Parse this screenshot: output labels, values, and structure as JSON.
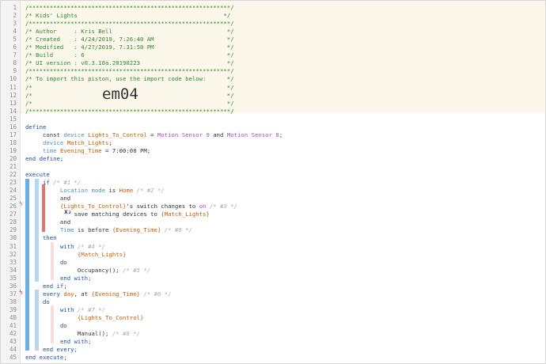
{
  "lines": [
    {
      "n": "1",
      "parts": [
        {
          "c": "cmt",
          "t": "/**********************************************************/"
        }
      ]
    },
    {
      "n": "2",
      "parts": [
        {
          "c": "cmt",
          "t": "/* Kids' Lights                                          */"
        }
      ]
    },
    {
      "n": "3",
      "parts": [
        {
          "c": "cmt",
          "t": "/**********************************************************/"
        }
      ]
    },
    {
      "n": "4",
      "parts": [
        {
          "c": "cmt",
          "t": "/* Author     : Kris Bell                                 */"
        }
      ]
    },
    {
      "n": "5",
      "parts": [
        {
          "c": "cmt",
          "t": "/* Created    : 4/24/2019, 7:26:40 AM                     */"
        }
      ]
    },
    {
      "n": "6",
      "parts": [
        {
          "c": "cmt",
          "t": "/* Modified   : 4/27/2019, 7:31:50 PM                     */"
        }
      ]
    },
    {
      "n": "7",
      "parts": [
        {
          "c": "cmt",
          "t": "/* Build      : 6                                         */"
        }
      ]
    },
    {
      "n": "8",
      "parts": [
        {
          "c": "cmt",
          "t": "/* UI version : v0.3.10a.20190223                         */"
        }
      ]
    },
    {
      "n": "9",
      "parts": [
        {
          "c": "cmt",
          "t": "/**********************************************************/"
        }
      ]
    },
    {
      "n": "10",
      "parts": [
        {
          "c": "cmt",
          "t": "/* To import this piston, use the import code below:      */"
        }
      ]
    },
    {
      "n": "11",
      "parts": [
        {
          "c": "cmt",
          "t": "/*                                                        */"
        }
      ]
    },
    {
      "n": "12",
      "parts": [
        {
          "c": "cmt",
          "t": "/*                                                        */"
        }
      ]
    },
    {
      "n": "13",
      "parts": [
        {
          "c": "cmt",
          "t": "/*                                                        */"
        }
      ]
    },
    {
      "n": "14",
      "parts": [
        {
          "c": "cmt",
          "t": "/**********************************************************/"
        }
      ]
    },
    {
      "n": "15",
      "parts": []
    },
    {
      "n": "16",
      "parts": [
        {
          "c": "kw",
          "t": "define"
        }
      ]
    },
    {
      "n": "17",
      "parts": [
        {
          "c": "plain",
          "t": "     const "
        },
        {
          "c": "ty",
          "t": "device "
        },
        {
          "c": "vr",
          "t": "Lights_To_Control"
        },
        {
          "c": "plain",
          "t": " = "
        },
        {
          "c": "dv",
          "t": "Motion Sensor 9"
        },
        {
          "c": "plain",
          "t": " and "
        },
        {
          "c": "dv",
          "t": "Motion Sensor 8"
        },
        {
          "c": "plain",
          "t": ";"
        }
      ]
    },
    {
      "n": "18",
      "parts": [
        {
          "c": "plain",
          "t": "     "
        },
        {
          "c": "ty",
          "t": "device "
        },
        {
          "c": "vr",
          "t": "Match_Lights"
        },
        {
          "c": "plain",
          "t": ";"
        }
      ]
    },
    {
      "n": "19",
      "parts": [
        {
          "c": "plain",
          "t": "     "
        },
        {
          "c": "ty",
          "t": "time "
        },
        {
          "c": "vr",
          "t": "Evening_Time"
        },
        {
          "c": "plain",
          "t": " = 7:00:00 PM;"
        }
      ]
    },
    {
      "n": "20",
      "parts": [
        {
          "c": "kw",
          "t": "end define;"
        }
      ]
    },
    {
      "n": "21",
      "parts": []
    },
    {
      "n": "22",
      "parts": [
        {
          "c": "kw",
          "t": "execute"
        }
      ]
    },
    {
      "n": "23",
      "parts": [
        {
          "c": "plain",
          "t": "     "
        },
        {
          "c": "kw",
          "t": "if "
        },
        {
          "c": "ic",
          "t": "/* #1 */"
        }
      ]
    },
    {
      "n": "24",
      "parts": [
        {
          "c": "plain",
          "t": "          "
        },
        {
          "c": "ty",
          "t": "Location mode"
        },
        {
          "c": "plain",
          "t": " is "
        },
        {
          "c": "vr",
          "t": "Home"
        },
        {
          "c": "ic",
          "t": " /* #2 */"
        }
      ]
    },
    {
      "n": "25",
      "parts": [
        {
          "c": "plain",
          "t": "          and"
        }
      ]
    },
    {
      "n": "26",
      "parts": [
        {
          "c": "plain",
          "t": "          "
        },
        {
          "c": "vr",
          "t": "{Lights_To_Control}"
        },
        {
          "c": "plain",
          "t": "'s switch changes to "
        },
        {
          "c": "st",
          "t": "on"
        },
        {
          "c": "ic",
          "t": " /* #3 */"
        }
      ]
    },
    {
      "n": "27",
      "parts": [
        {
          "c": "plain",
          "t": "              save matching devices to "
        },
        {
          "c": "vr",
          "t": "{Match_Lights}"
        }
      ]
    },
    {
      "n": "28",
      "parts": [
        {
          "c": "plain",
          "t": "          and"
        }
      ]
    },
    {
      "n": "29",
      "parts": [
        {
          "c": "plain",
          "t": "          "
        },
        {
          "c": "ty",
          "t": "Time"
        },
        {
          "c": "plain",
          "t": " is before "
        },
        {
          "c": "vr",
          "t": "{Evening_Time}"
        },
        {
          "c": "ic",
          "t": " /* #9 */"
        }
      ]
    },
    {
      "n": "30",
      "parts": [
        {
          "c": "plain",
          "t": "     "
        },
        {
          "c": "kw",
          "t": "then"
        }
      ]
    },
    {
      "n": "31",
      "parts": [
        {
          "c": "plain",
          "t": "          "
        },
        {
          "c": "kw",
          "t": "with "
        },
        {
          "c": "ic",
          "t": "/* #4 */"
        }
      ]
    },
    {
      "n": "32",
      "parts": [
        {
          "c": "plain",
          "t": "               "
        },
        {
          "c": "vr",
          "t": "{Match_Lights}"
        }
      ]
    },
    {
      "n": "33",
      "parts": [
        {
          "c": "plain",
          "t": "          "
        },
        {
          "c": "kw",
          "t": "do"
        }
      ]
    },
    {
      "n": "34",
      "parts": [
        {
          "c": "plain",
          "t": "               Occupancy(); "
        },
        {
          "c": "ic",
          "t": "/* #5 */"
        }
      ]
    },
    {
      "n": "35",
      "parts": [
        {
          "c": "plain",
          "t": "          "
        },
        {
          "c": "kw",
          "t": "end with;"
        }
      ]
    },
    {
      "n": "36",
      "parts": [
        {
          "c": "plain",
          "t": "     "
        },
        {
          "c": "kw",
          "t": "end if;"
        }
      ]
    },
    {
      "n": "37",
      "parts": [
        {
          "c": "plain",
          "t": "     "
        },
        {
          "c": "kw",
          "t": "every "
        },
        {
          "c": "vr",
          "t": "day"
        },
        {
          "c": "plain",
          "t": ", at "
        },
        {
          "c": "vr",
          "t": "{Evening_Time}"
        },
        {
          "c": "ic",
          "t": " /* #6 */"
        }
      ]
    },
    {
      "n": "38",
      "parts": [
        {
          "c": "plain",
          "t": "     "
        },
        {
          "c": "kw",
          "t": "do"
        }
      ]
    },
    {
      "n": "39",
      "parts": [
        {
          "c": "plain",
          "t": "          "
        },
        {
          "c": "kw",
          "t": "with "
        },
        {
          "c": "ic",
          "t": "/* #7 */"
        }
      ]
    },
    {
      "n": "40",
      "parts": [
        {
          "c": "plain",
          "t": "               "
        },
        {
          "c": "vr",
          "t": "{Lights_To_Control}"
        }
      ]
    },
    {
      "n": "41",
      "parts": [
        {
          "c": "plain",
          "t": "          "
        },
        {
          "c": "kw",
          "t": "do"
        }
      ]
    },
    {
      "n": "42",
      "parts": [
        {
          "c": "plain",
          "t": "               Manual(); "
        },
        {
          "c": "ic",
          "t": "/* #8 */"
        }
      ]
    },
    {
      "n": "43",
      "parts": [
        {
          "c": "plain",
          "t": "          "
        },
        {
          "c": "kw",
          "t": "end with;"
        }
      ]
    },
    {
      "n": "44",
      "parts": [
        {
          "c": "plain",
          "t": "     "
        },
        {
          "c": "kw",
          "t": "end every;"
        }
      ]
    },
    {
      "n": "45",
      "parts": [
        {
          "c": "kw",
          "t": "end execute;"
        }
      ]
    }
  ],
  "import_code": "em04",
  "colors": {
    "comment": "#2b8a2b",
    "keyword": "#1a4fa6",
    "variable": "#c25d00",
    "device": "#a24bd0",
    "header_bg": "#fbf7ea",
    "execute_bar": "#6aaee6",
    "condition_bar": "#e57373"
  },
  "markers": {
    "trigger_glyph": "ϟ",
    "timer_glyph": "ϟ",
    "task_glyph": "x₂"
  }
}
